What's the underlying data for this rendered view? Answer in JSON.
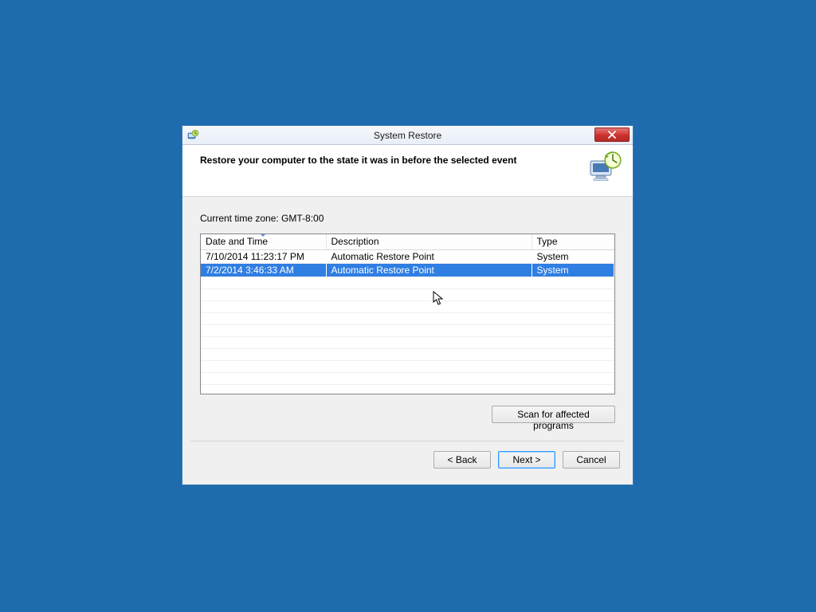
{
  "window": {
    "title": "System Restore"
  },
  "header": {
    "heading": "Restore your computer to the state it was in before the selected event"
  },
  "timezone_label": "Current time zone: GMT-8:00",
  "table": {
    "columns": {
      "date": "Date and Time",
      "desc": "Description",
      "type": "Type"
    },
    "rows": [
      {
        "date": "7/10/2014 11:23:17 PM",
        "desc": "Automatic Restore Point",
        "type": "System",
        "selected": false
      },
      {
        "date": "7/2/2014 3:46:33 AM",
        "desc": "Automatic Restore Point",
        "type": "System",
        "selected": true
      }
    ]
  },
  "buttons": {
    "scan": "Scan for affected programs",
    "back": "< Back",
    "next": "Next >",
    "cancel": "Cancel"
  }
}
